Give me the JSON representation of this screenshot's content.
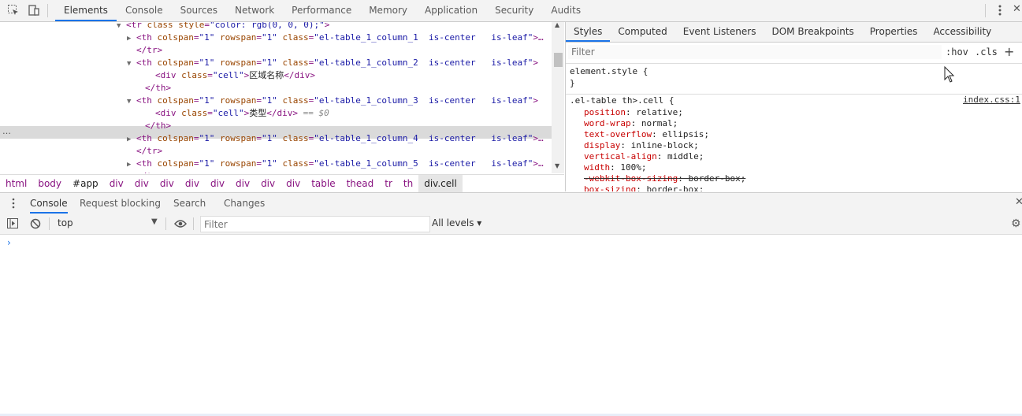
{
  "top_tabs": [
    "Elements",
    "Console",
    "Sources",
    "Network",
    "Performance",
    "Memory",
    "Application",
    "Security",
    "Audits"
  ],
  "active_top_tab": "Elements",
  "dom_lines": [
    {
      "indent": 160,
      "tri": "▼",
      "parts": [
        [
          "tag",
          "<tr "
        ],
        [
          "attr",
          "class style"
        ],
        [
          "tag",
          "="
        ],
        [
          "val",
          "\"color: rgb(0, 0, 0);\""
        ],
        [
          "tag",
          ">"
        ]
      ]
    },
    {
      "indent": 173,
      "tri": "▶",
      "parts": [
        [
          "tag",
          "<th "
        ],
        [
          "attr",
          "colspan"
        ],
        [
          "tag",
          "="
        ],
        [
          "val",
          "\"1\""
        ],
        [
          "tag",
          " "
        ],
        [
          "attr",
          "rowspan"
        ],
        [
          "tag",
          "="
        ],
        [
          "val",
          "\"1\""
        ],
        [
          "tag",
          " "
        ],
        [
          "attr",
          "class"
        ],
        [
          "tag",
          "="
        ],
        [
          "val",
          "\"el-table_1_column_1  is-center   is-leaf\""
        ],
        [
          "tag",
          ">…"
        ]
      ]
    },
    {
      "indent": 173,
      "tri": "",
      "parts": [
        [
          "tag",
          "</tr>"
        ]
      ]
    },
    {
      "indent": 173,
      "tri": "▼",
      "parts": [
        [
          "tag",
          "<th "
        ],
        [
          "attr",
          "colspan"
        ],
        [
          "tag",
          "="
        ],
        [
          "val",
          "\"1\""
        ],
        [
          "tag",
          " "
        ],
        [
          "attr",
          "rowspan"
        ],
        [
          "tag",
          "="
        ],
        [
          "val",
          "\"1\""
        ],
        [
          "tag",
          " "
        ],
        [
          "attr",
          "class"
        ],
        [
          "tag",
          "="
        ],
        [
          "val",
          "\"el-table_1_column_2  is-center   is-leaf\""
        ],
        [
          "tag",
          ">"
        ]
      ]
    },
    {
      "indent": 197,
      "tri": "",
      "parts": [
        [
          "tag",
          "<div "
        ],
        [
          "attr",
          "class"
        ],
        [
          "tag",
          "="
        ],
        [
          "val",
          "\"cell\""
        ],
        [
          "tag",
          ">"
        ],
        [
          "txt",
          "区域名称"
        ],
        [
          "tag",
          "</div>"
        ]
      ]
    },
    {
      "indent": 184,
      "tri": "",
      "parts": [
        [
          "tag",
          "</th>"
        ]
      ]
    },
    {
      "indent": 173,
      "tri": "▼",
      "parts": [
        [
          "tag",
          "<th "
        ],
        [
          "attr",
          "colspan"
        ],
        [
          "tag",
          "="
        ],
        [
          "val",
          "\"1\""
        ],
        [
          "tag",
          " "
        ],
        [
          "attr",
          "rowspan"
        ],
        [
          "tag",
          "="
        ],
        [
          "val",
          "\"1\""
        ],
        [
          "tag",
          " "
        ],
        [
          "attr",
          "class"
        ],
        [
          "tag",
          "="
        ],
        [
          "val",
          "\"el-table_1_column_3  is-center   is-leaf\""
        ],
        [
          "tag",
          ">"
        ]
      ]
    },
    {
      "indent": 197,
      "tri": "",
      "parts": [
        [
          "tag",
          "<div "
        ],
        [
          "attr",
          "class"
        ],
        [
          "tag",
          "="
        ],
        [
          "val",
          "\"cell\""
        ],
        [
          "tag",
          ">"
        ],
        [
          "txt",
          "类型"
        ],
        [
          "tag",
          "</div>"
        ],
        [
          "dim",
          " == $0"
        ]
      ]
    },
    {
      "indent": 184,
      "tri": "",
      "parts": [
        [
          "tag",
          "</th>"
        ]
      ]
    },
    {
      "indent": 173,
      "tri": "▶",
      "parts": [
        [
          "tag",
          "<th "
        ],
        [
          "attr",
          "colspan"
        ],
        [
          "tag",
          "="
        ],
        [
          "val",
          "\"1\""
        ],
        [
          "tag",
          " "
        ],
        [
          "attr",
          "rowspan"
        ],
        [
          "tag",
          "="
        ],
        [
          "val",
          "\"1\""
        ],
        [
          "tag",
          " "
        ],
        [
          "attr",
          "class"
        ],
        [
          "tag",
          "="
        ],
        [
          "val",
          "\"el-table_1_column_4  is-center   is-leaf\""
        ],
        [
          "tag",
          ">…"
        ]
      ]
    },
    {
      "indent": 173,
      "tri": "",
      "parts": [
        [
          "tag",
          "</tr>"
        ]
      ]
    },
    {
      "indent": 173,
      "tri": "▶",
      "parts": [
        [
          "tag",
          "<th "
        ],
        [
          "attr",
          "colspan"
        ],
        [
          "tag",
          "="
        ],
        [
          "val",
          "\"1\""
        ],
        [
          "tag",
          " "
        ],
        [
          "attr",
          "rowspan"
        ],
        [
          "tag",
          "="
        ],
        [
          "val",
          "\"1\""
        ],
        [
          "tag",
          " "
        ],
        [
          "attr",
          "class"
        ],
        [
          "tag",
          "="
        ],
        [
          "val",
          "\"el-table_1_column_5  is-center   is-leaf\""
        ],
        [
          "tag",
          ">…"
        ]
      ]
    },
    {
      "indent": 173,
      "tri": "",
      "parts": [
        [
          "tag",
          "</tr>"
        ]
      ]
    }
  ],
  "selected_dots": "…",
  "breadcrumb": [
    "html",
    "body",
    "#app",
    "div",
    "div",
    "div",
    "div",
    "div",
    "div",
    "div",
    "div",
    "table",
    "thead",
    "tr",
    "th",
    "div.cell"
  ],
  "styles_tabs": [
    "Styles",
    "Computed",
    "Event Listeners",
    "DOM Breakpoints",
    "Properties",
    "Accessibility"
  ],
  "styles_filter_placeholder": "Filter",
  "hov_label": ":hov",
  "cls_label": ".cls",
  "plus_label": "+",
  "element_style_selector": "element.style {",
  "element_style_close": "}",
  "rule_selector": ".el-table th>.cell {",
  "rule_source": "index.css:1",
  "rule_props": [
    {
      "name": "position",
      "value": "relative;",
      "struck": false
    },
    {
      "name": "word-wrap",
      "value": "normal;",
      "struck": false
    },
    {
      "name": "text-overflow",
      "value": "ellipsis;",
      "struck": false
    },
    {
      "name": "display",
      "value": "inline-block;",
      "struck": false
    },
    {
      "name": "vertical-align",
      "value": "middle;",
      "struck": false
    },
    {
      "name": "width",
      "value": "100%;",
      "struck": false
    },
    {
      "name": "-webkit-box-sizing",
      "value": "border-box;",
      "struck": true
    },
    {
      "name": "box-sizing",
      "value": "border-box;",
      "struck": false
    }
  ],
  "drawer_tabs": [
    "Console",
    "Request blocking",
    "Search",
    "Changes"
  ],
  "active_drawer_tab": "Console",
  "console_context": "top",
  "console_filter_placeholder": "Filter",
  "log_levels": "All levels ▾",
  "prompt": "›",
  "close_glyph": "✕",
  "colors": {
    "accent": "#1a73e8",
    "tag": "#881280",
    "attr": "#994500",
    "value": "#1a1aa6",
    "css_prop": "#c80000"
  }
}
